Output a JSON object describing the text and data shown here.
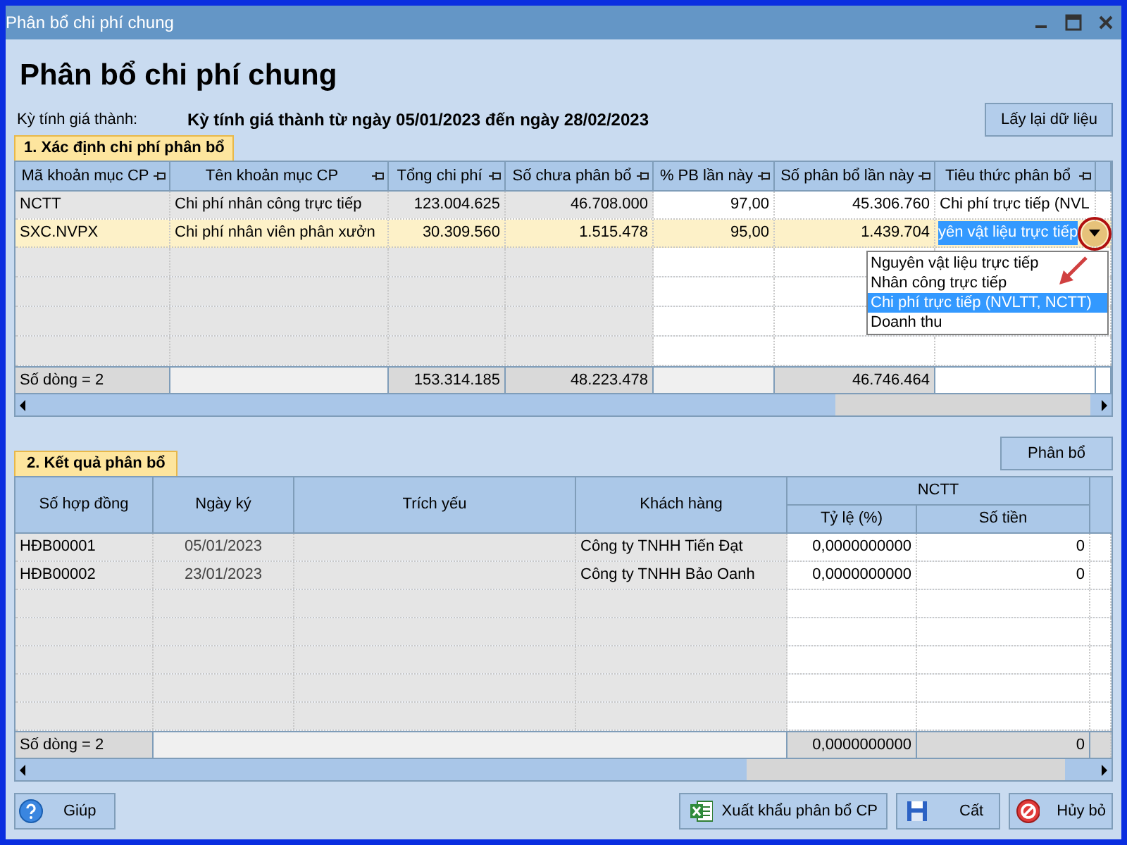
{
  "window": {
    "title": "Phân bổ chi phí chung"
  },
  "heading": "Phân bổ chi phí chung",
  "period": {
    "label": "Kỳ tính giá thành:",
    "value": "Kỳ tính giá thành từ ngày 05/01/2023 đến ngày 28/02/2023"
  },
  "reload_button": "Lấy lại dữ liệu",
  "section_1": {
    "tab": "1. Xác định chi phí phân bổ",
    "columns": [
      "Mã khoản mục CP",
      "Tên khoản mục CP",
      "Tổng chi phí",
      "Số chưa phân bổ",
      "% PB lần này",
      "Số phân bổ lần này",
      "Tiêu thức phân bổ"
    ],
    "rows": [
      {
        "selected": false,
        "cells": [
          "NCTT",
          "Chi phí nhân công trực tiếp",
          "123.004.625",
          "46.708.000",
          "97,00",
          "45.306.760",
          "Chi phí trực tiếp (NVL"
        ]
      },
      {
        "selected": true,
        "cells": [
          "SXC.NVPX",
          "Chi phí nhân viên phân xưởn",
          "30.309.560",
          "1.515.478",
          "95,00",
          "1.439.704",
          "yên vật liệu trực tiếp"
        ]
      }
    ],
    "footer": {
      "row_count": "Số dòng = 2",
      "total_cost": "153.314.185",
      "unallocated": "48.223.478",
      "allocated": "46.746.464"
    },
    "dropdown": {
      "open": true,
      "options": [
        {
          "label": "Nguyên vật liệu trực tiếp",
          "selected": false
        },
        {
          "label": "Nhân công trực tiếp",
          "selected": false
        },
        {
          "label": "Chi phí trực tiếp (NVLTT, NCTT)",
          "selected": true
        },
        {
          "label": "Doanh thu",
          "selected": false
        }
      ]
    }
  },
  "allocate_button": "Phân bổ",
  "section_2": {
    "tab": "2. Kết quả phân bổ",
    "columns": [
      "Số hợp đồng",
      "Ngày ký",
      "Trích yếu",
      "Khách hàng"
    ],
    "group": {
      "title": "NCTT",
      "columns": [
        "Tỷ lệ (%)",
        "Số tiền"
      ]
    },
    "rows": [
      {
        "contract": "HĐB00001",
        "date": "05/01/2023",
        "customer": "Công ty TNHH Tiến Đạt",
        "rate": "0,0000000000",
        "amount": "0"
      },
      {
        "contract": "HĐB00002",
        "date": "23/01/2023",
        "customer": "Công ty TNHH Bảo Oanh",
        "rate": "0,0000000000",
        "amount": "0"
      }
    ],
    "footer": {
      "row_count": "Số dòng = 2",
      "rate": "0,0000000000",
      "amount": "0"
    }
  },
  "buttons": {
    "help": "Giúp",
    "export": "Xuất khẩu phân bổ CP",
    "save": "Cất",
    "cancel": "Hủy bỏ"
  }
}
